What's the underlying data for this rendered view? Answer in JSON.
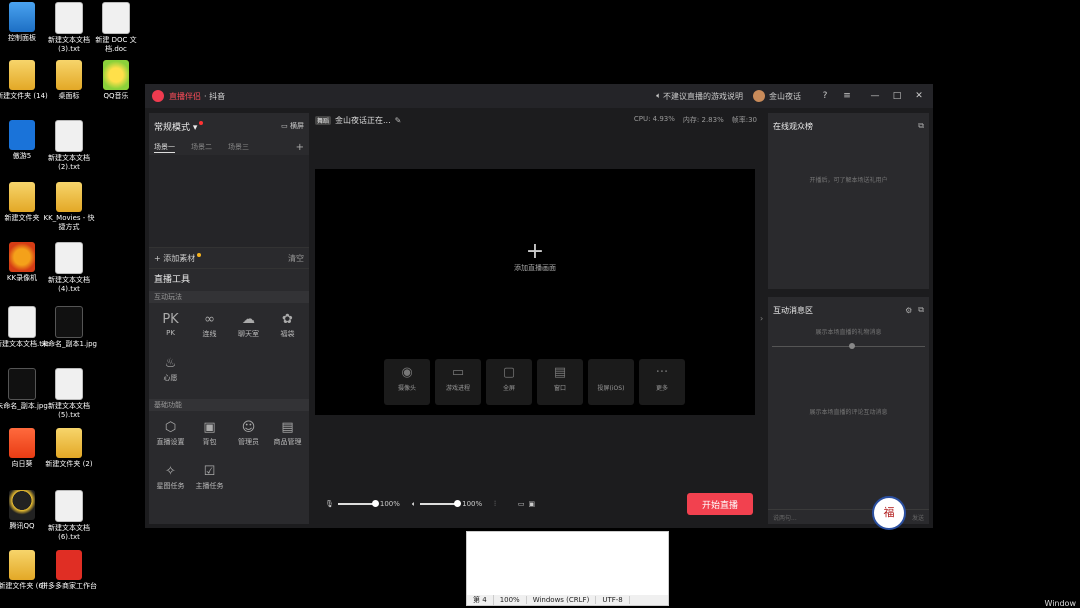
{
  "desktop": {
    "icons": [
      {
        "label": "控制面板",
        "kind": "ctrl"
      },
      {
        "label": "新建文本文档 (3).txt",
        "kind": "doc"
      },
      {
        "label": "新建 DOC 文档.doc",
        "kind": "doc"
      },
      {
        "label": "新建文件夹 (14)",
        "kind": "folder"
      },
      {
        "label": "桌面标",
        "kind": "folder"
      },
      {
        "label": "QQ音乐",
        "kind": "qq"
      },
      {
        "label": "傲游5",
        "kind": "mx"
      },
      {
        "label": "新建文本文档 (2).txt",
        "kind": "doc"
      },
      {
        "label": "新建文件夹",
        "kind": "folder"
      },
      {
        "label": "KK_Movies - 快捷方式",
        "kind": "folder"
      },
      {
        "label": "KK录像机",
        "kind": "kk"
      },
      {
        "label": "新建文本文档 (4).txt",
        "kind": "doc"
      },
      {
        "label": "新建文本文档.txt",
        "kind": "doc"
      },
      {
        "label": "未命名_副本1.jpg",
        "kind": "film"
      },
      {
        "label": "未命名_副本.jpg",
        "kind": "film"
      },
      {
        "label": "新建文本文档 (5).txt",
        "kind": "doc"
      },
      {
        "label": "向日葵",
        "kind": "xrk"
      },
      {
        "label": "新建文件夹 (2)",
        "kind": "folder"
      },
      {
        "label": "腾讯QQ",
        "kind": "penguin"
      },
      {
        "label": "新建文本文档 (6).txt",
        "kind": "doc"
      },
      {
        "label": "新建文件夹 (6)",
        "kind": "folder"
      },
      {
        "label": "拼多多商家工作台",
        "kind": "pdd"
      }
    ]
  },
  "window": {
    "app_name": "直播伴侣",
    "platform": "· 抖音",
    "notice": "不建议直播的游戏说明",
    "username": "金山夜话",
    "help_icon": "?",
    "menu_icon": "≡",
    "min": "—",
    "max": "□",
    "close": "✕"
  },
  "left": {
    "mode": "常规模式 ▾",
    "screen": "横屏",
    "scenes": [
      "场景一",
      "场景二",
      "场景三"
    ],
    "scene_add": "+",
    "add_source": "+ 添加素材",
    "clear": "清空",
    "tools_title": "直播工具",
    "interactive_title": "互动玩法",
    "interactive": [
      {
        "label": "PK",
        "icon": "PK"
      },
      {
        "label": "连线",
        "icon": "∞"
      },
      {
        "label": "聊天室",
        "icon": "☁"
      },
      {
        "label": "福袋",
        "icon": "✿"
      },
      {
        "label": "心愿",
        "icon": "♨"
      }
    ],
    "basic_title": "基础功能",
    "basic": [
      {
        "label": "直播设置",
        "icon": "⬡"
      },
      {
        "label": "背包",
        "icon": "▣"
      },
      {
        "label": "管理员",
        "icon": "☺"
      },
      {
        "label": "商品管理",
        "icon": "▤"
      },
      {
        "label": "星图任务",
        "icon": "✧"
      },
      {
        "label": "主播任务",
        "icon": "☑"
      }
    ]
  },
  "center": {
    "tag": "舞蹈",
    "stream_title": "金山夜话正在...",
    "cpu": "CPU: 4.93%",
    "mem": "内存: 2.83%",
    "fps": "帧率:30",
    "add_live": "添加直播画面",
    "add_plus": "+",
    "sources": [
      {
        "label": "摄像头",
        "icon": "◉"
      },
      {
        "label": "游戏进程",
        "icon": "▭"
      },
      {
        "label": "全屏",
        "icon": "▢"
      },
      {
        "label": "窗口",
        "icon": "▤"
      },
      {
        "label": "投屏(iOS)",
        "icon": ""
      },
      {
        "label": "更多",
        "icon": "···"
      }
    ],
    "mic_volume": "100%",
    "speaker_volume": "100%",
    "start": "开始直播"
  },
  "right": {
    "audience_title": "在线观众榜",
    "audience_note": "开播后，可了解本场送礼用户",
    "interaction_title": "互动消息区",
    "gift_note": "展示本场直播的礼物消息",
    "comment_note": "展示本场直播的评论互动消息",
    "input_placeholder": "说两句...",
    "send": "发送",
    "badge": "福"
  },
  "notepad": {
    "line": "第 4",
    "zoom": "100%",
    "eol": "Windows (CRLF)",
    "enc": "UTF-8"
  },
  "taskbar_label": "Window"
}
